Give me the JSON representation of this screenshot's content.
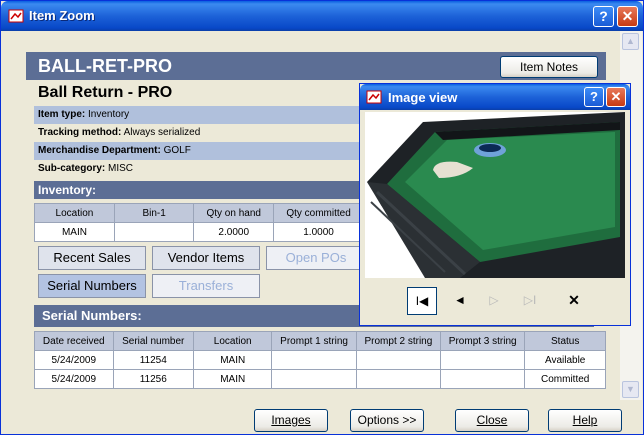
{
  "window": {
    "title": "Item Zoom",
    "help": "?",
    "close": "✕"
  },
  "header": {
    "code": "BALL-RET-PRO",
    "notes_button": "Item Notes"
  },
  "item": {
    "name": "Ball Return - PRO",
    "type_label": "Item type:",
    "type_value": "Inventory",
    "tracking_label": "Tracking method:",
    "tracking_value": "Always serialized",
    "dept_label": "Merchandise Department:",
    "dept_value": "GOLF",
    "subcat_label": "Sub-category:",
    "subcat_value": "MISC"
  },
  "inventory": {
    "title": "Inventory:",
    "columns": [
      "Location",
      "Bin-1",
      "Qty on hand",
      "Qty committed"
    ],
    "rows": [
      [
        "MAIN",
        "",
        "2.0000",
        "1.0000"
      ]
    ]
  },
  "tabs": {
    "recent_sales": "Recent Sales",
    "vendor_items": "Vendor Items",
    "open_pos": "Open POs",
    "serial_numbers": "Serial Numbers",
    "transfers": "Transfers"
  },
  "serials": {
    "title": "Serial Numbers:",
    "columns": [
      "Date received",
      "Serial number",
      "Location",
      "Prompt 1 string",
      "Prompt 2 string",
      "Prompt 3 string",
      "Status"
    ],
    "rows": [
      [
        "5/24/2009",
        "11254",
        "MAIN",
        "",
        "",
        "",
        "Available"
      ],
      [
        "5/24/2009",
        "11256",
        "MAIN",
        "",
        "",
        "",
        "Committed"
      ]
    ]
  },
  "footer": {
    "images": "Images",
    "options": "Options >>",
    "close": "Close",
    "help": "Help"
  },
  "image_view": {
    "title": "Image view",
    "help": "?",
    "close": "✕",
    "nav": {
      "first": "first-record-icon",
      "prev": "prev-icon",
      "next": "next-icon",
      "last": "last-record-icon",
      "delete": "delete-icon"
    }
  }
}
